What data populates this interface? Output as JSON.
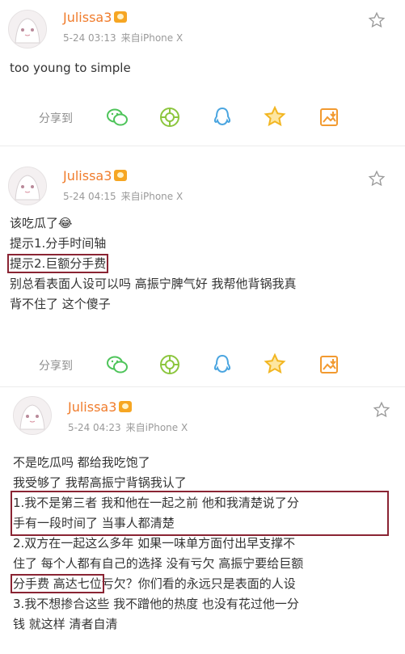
{
  "posts": [
    {
      "username": "Julissa3",
      "time": "5-24 03:13",
      "source": "来自iPhone X",
      "lines": [
        "too young to simple"
      ],
      "share_label": "分享到"
    },
    {
      "username": "Julissa3",
      "time": "5-24 04:15",
      "source": "来自iPhone X",
      "lines": [
        "该吃瓜了😂",
        "提示1.分手时间轴",
        "提示2.巨额分手费",
        "别总看表面人设可以吗 高振宁脾气好 我帮他背锅我真",
        "背不住了 这个傻子"
      ],
      "share_label": "分享到"
    },
    {
      "username": "Julissa3",
      "time": "5-24 04:23",
      "source": "来自iPhone X",
      "lines": [
        "不是吃瓜吗 都给我吃饱了",
        "我受够了 我帮高振宁背锅我认了",
        "1.我不是第三者 我和他在一起之前 他和我清楚说了分",
        "手有一段时间了 当事人都清楚",
        "2.双方在一起这么多年 如果一味单方面付出早支撑不",
        "住了 每个人都有自己的选择 没有亏欠 高振宁要给巨额",
        "分手费 高达七位",
        "亏欠？你们看的永远只是表面的人设",
        "3.我不想掺合这些 我不蹭他的热度 也没有花过他一分",
        "钱 就这样 清者自清"
      ]
    }
  ],
  "icons": {
    "wechat": "wechat-icon",
    "moments": "moments-icon",
    "qq": "qq-icon",
    "qzone": "qzone-star-icon",
    "save": "save-image-icon"
  },
  "colors": {
    "username": "#f07c2c",
    "highlight_box": "#8a2433",
    "share_icon": "#4ec45a"
  }
}
